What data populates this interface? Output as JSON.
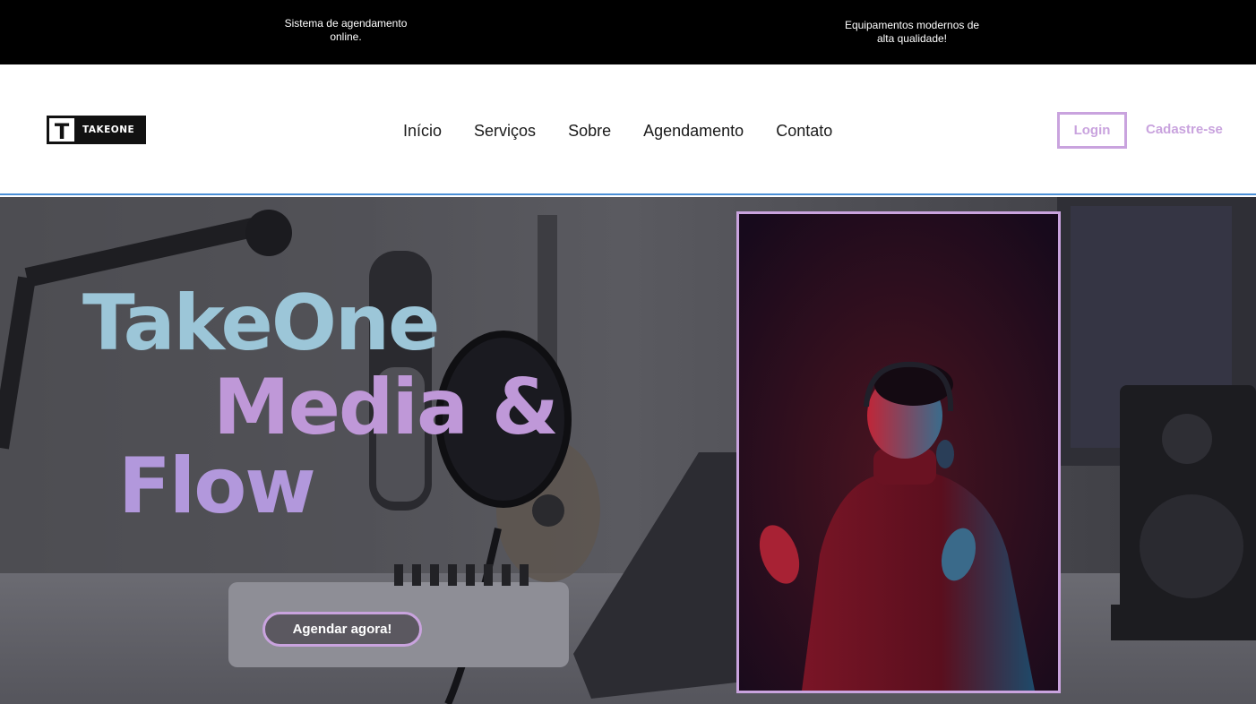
{
  "topbar": {
    "info_left": "Sistema de agendamento online.",
    "info_right": "Equipamentos  modernos de alta qualidade!"
  },
  "header": {
    "logo_letter": "T",
    "logo_text": "TAKEONE",
    "nav": [
      "Início",
      "Serviços",
      "Sobre",
      "Agendamento",
      "Contato"
    ],
    "login_label": "Login",
    "signup_label": "Cadastre-se"
  },
  "hero": {
    "title_line1": "TakeOne",
    "title_line2": "Media &",
    "title_line3": "Flow",
    "cta_label": "Agendar agora!",
    "photo_description_icon": "person-with-headphones-photo"
  },
  "colors": {
    "topbar_bg": "#000000",
    "accent_purple": "#c9a3de",
    "title_blue": "#9cc6d8",
    "title_purple": "#bf98d8",
    "header_divider": "#4a8fd6"
  }
}
